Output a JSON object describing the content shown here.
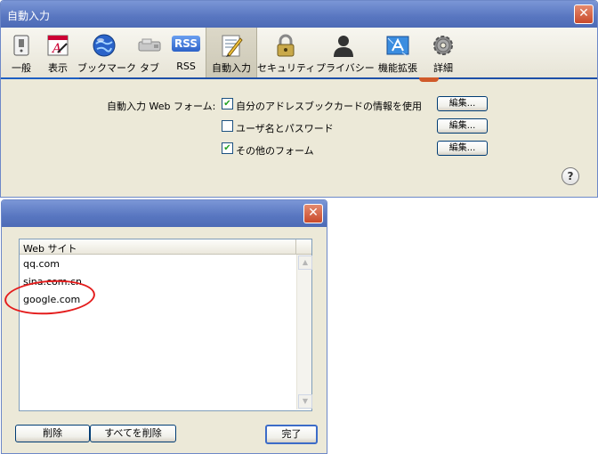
{
  "prefs_window": {
    "title": "自動入力",
    "close_glyph": "✕",
    "toolbar": [
      {
        "label": "一般",
        "icon": "switch-icon"
      },
      {
        "label": "表示",
        "icon": "font-icon"
      },
      {
        "label": "ブックマーク",
        "icon": "globe-icon"
      },
      {
        "label": "タブ",
        "icon": "tabs-icon"
      },
      {
        "label": "RSS",
        "icon": "rss-icon",
        "icon_text": "RSS"
      },
      {
        "label": "自動入力",
        "icon": "pencil-icon",
        "selected": true
      },
      {
        "label": "セキュリティ",
        "icon": "lock-icon"
      },
      {
        "label": "プライバシー",
        "icon": "person-icon"
      },
      {
        "label": "機能拡張",
        "icon": "extension-icon"
      },
      {
        "label": "詳細",
        "icon": "gear-icon"
      }
    ],
    "form_label": "自動入力 Web フォーム:",
    "options": [
      {
        "label": "自分のアドレスブックカードの情報を使用",
        "checked": true,
        "edit_label": "編集..."
      },
      {
        "label": "ユーザ名とパスワード",
        "checked": false,
        "edit_label": "編集..."
      },
      {
        "label": "その他のフォーム",
        "checked": true,
        "edit_label": "編集..."
      }
    ],
    "help_glyph": "?"
  },
  "sites_window": {
    "close_glyph": "✕",
    "column_header": "Web サイト",
    "sites": [
      "qq.com",
      "sina.com.cn",
      "google.com"
    ],
    "buttons": {
      "delete": "削除",
      "delete_all": "すべてを削除",
      "done": "完了"
    }
  },
  "colors": {
    "annotation_circle": "#e41c1c",
    "titlebar": "#5876c0"
  }
}
